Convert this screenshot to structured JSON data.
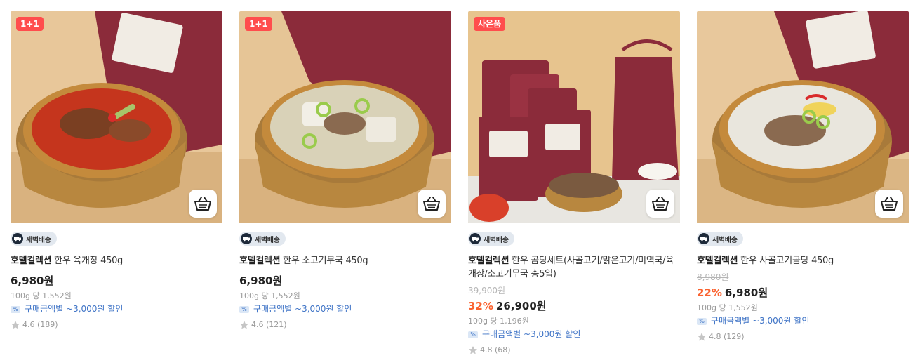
{
  "colors": {
    "tag_bg": "#ff4d4d",
    "discount": "#fa622f",
    "coupon": "#3e73c6",
    "badge_bg": "#e2e8ef"
  },
  "products": [
    {
      "tag": "1+1",
      "delivery_badge": "새벽배송",
      "brand": "호텔컬렉션",
      "name": "한우 육개장 450g",
      "price": "6,980원",
      "unit_price": "100g 당 1,552원",
      "coupon": "구매금액별 ~3,000원 할인",
      "rating": "4.6",
      "review_count": "(189)",
      "icons": {
        "cart": "basket-icon",
        "star": "star-icon",
        "truck": "truck-icon"
      }
    },
    {
      "tag": "1+1",
      "delivery_badge": "새벽배송",
      "brand": "호텔컬렉션",
      "name": "한우 소고기무국 450g",
      "price": "6,980원",
      "unit_price": "100g 당 1,552원",
      "coupon": "구매금액별 ~3,000원 할인",
      "rating": "4.6",
      "review_count": "(121)"
    },
    {
      "tag": "사은품",
      "delivery_badge": "새벽배송",
      "brand": "호텔컬렉션",
      "name": "한우 곰탕세트(사골고기/맑은고기/미역국/육개장/소고기무국 총5입)",
      "original_price": "39,900원",
      "discount_rate": "32%",
      "price": "26,900원",
      "unit_price": "100g 당 1,196원",
      "coupon": "구매금액별 ~3,000원 할인",
      "rating": "4.8",
      "review_count": "(68)"
    },
    {
      "delivery_badge": "새벽배송",
      "brand": "호텔컬렉션",
      "name": "한우 사골고기곰탕 450g",
      "original_price": "8,980원",
      "discount_rate": "22%",
      "price": "6,980원",
      "unit_price": "100g 당 1,552원",
      "coupon": "구매금액별 ~3,000원 할인",
      "rating": "4.8",
      "review_count": "(129)"
    }
  ]
}
